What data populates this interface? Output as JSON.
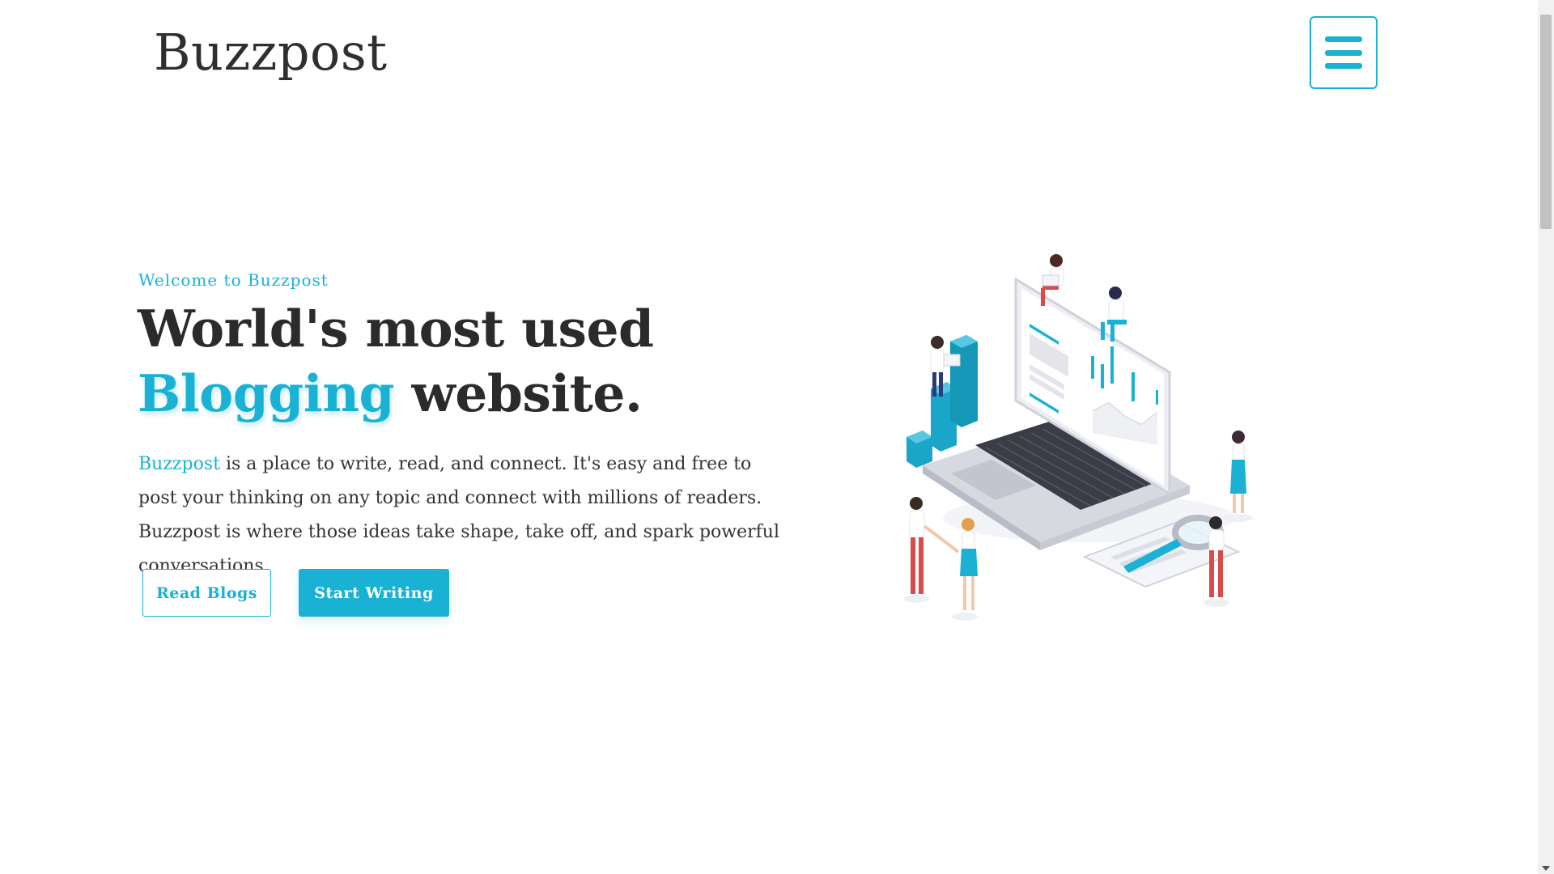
{
  "header": {
    "logo": "Buzzpost",
    "menu_button_icon": "hamburger-menu-icon"
  },
  "hero": {
    "eyebrow": "Welcome to Buzzpost",
    "headline_line1": "World's most used",
    "headline_accent": "Blogging",
    "headline_rest": " website.",
    "description_brand": "Buzzpost",
    "description_text": " is a place to write, read, and connect. It's easy and free to post your thinking on any topic and connect with millions of readers. Buzzpost is where those ideas take shape, take off, and spark powerful conversations.",
    "read_button": "Read Blogs",
    "write_button": "Start Writing",
    "illustration": "isometric-laptop-analytics-illustration"
  },
  "colors": {
    "accent": "#19b1d4",
    "text": "#2b2b2b",
    "background": "#ffffff"
  }
}
